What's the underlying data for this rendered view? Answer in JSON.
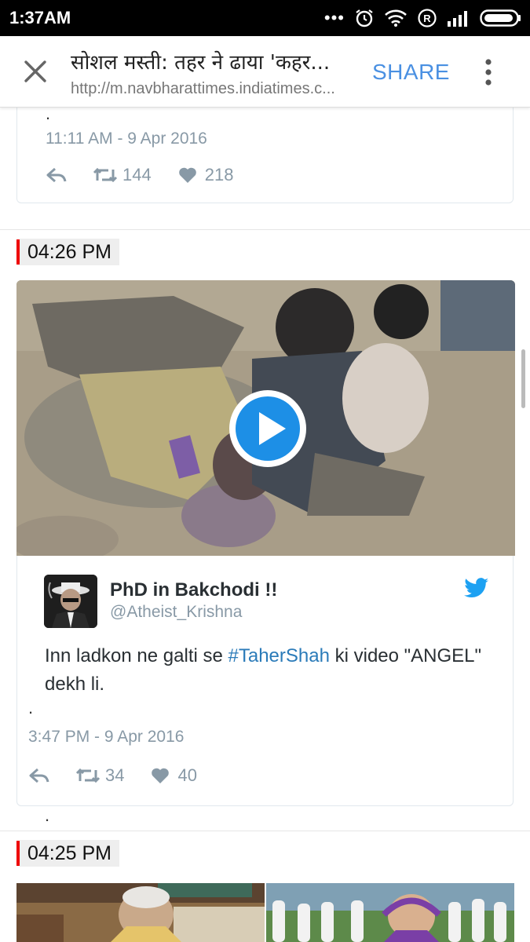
{
  "status_bar": {
    "time": "1:37AM"
  },
  "toolbar": {
    "title": "सोशल मस्ती: तहर ने ढाया 'कहर...",
    "url": "http://m.navbharattimes.indiatimes.c...",
    "share_label": "SHARE"
  },
  "tweet_prev": {
    "dot": ".",
    "timestamp": "11:11 AM - 9 Apr 2016",
    "retweets": "144",
    "likes": "218"
  },
  "section_1": {
    "time": "04:26 PM"
  },
  "tweet_1": {
    "name": "PhD in Bakchodi !!",
    "handle": "@Atheist_Krishna",
    "text_before": "Inn ladkon ne galti se ",
    "hashtag": "#TaherShah",
    "text_after": " ki video \"ANGEL\" dekh li.",
    "dot": ".",
    "timestamp": "3:47 PM - 9 Apr 2016",
    "retweets": "34",
    "likes": "40"
  },
  "section_2": {
    "time": "04:25 PM"
  },
  "colors": {
    "link": "#2b7bb9",
    "share": "#4a90e2",
    "play": "#1d8fe6",
    "accent_bar": "#e00000"
  }
}
